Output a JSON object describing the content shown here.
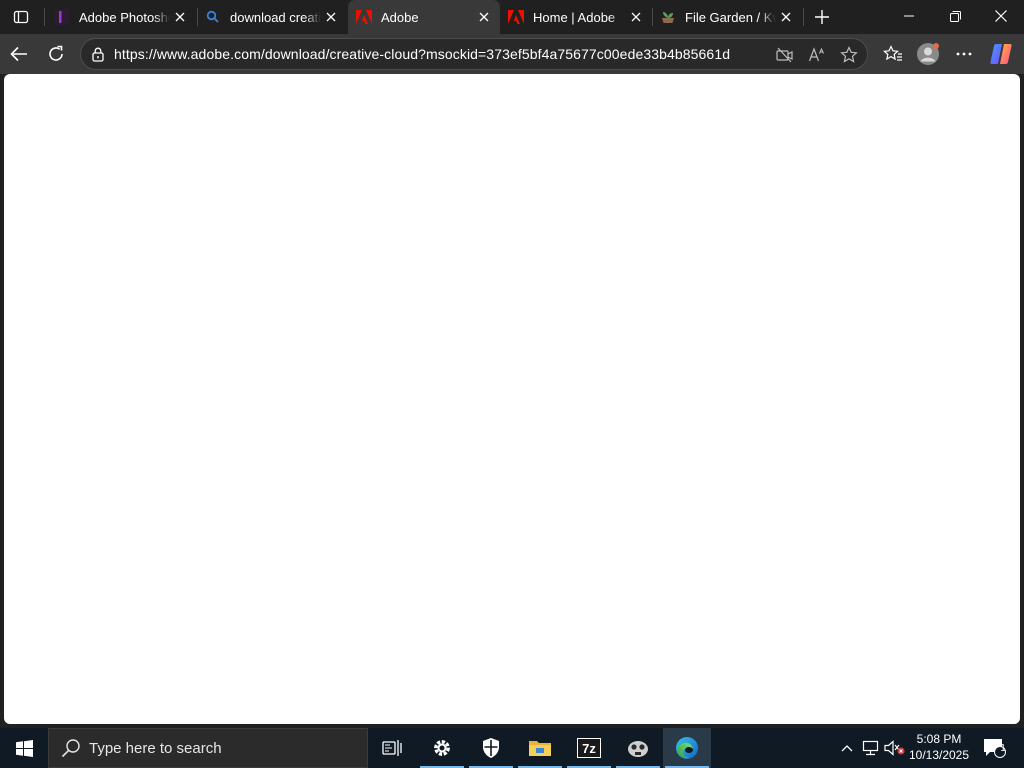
{
  "browser": {
    "tabs": [
      {
        "title": "Adobe Photoshop",
        "icon": "photoshop-favicon-icon",
        "active": false
      },
      {
        "title": "download creative cloud",
        "icon": "search-favicon-icon",
        "active": false
      },
      {
        "title": "Adobe",
        "icon": "adobe-favicon-icon",
        "active": true
      },
      {
        "title": "Home | Adobe",
        "icon": "adobe-favicon-icon",
        "active": false
      },
      {
        "title": "File Garden / Kvu",
        "icon": "file-garden-favicon-icon",
        "active": false
      }
    ],
    "address_bar": {
      "url": "https://www.adobe.com/download/creative-cloud?msockid=373ef5bf4a75677c00ede33b4b85661d"
    },
    "colors": {
      "tabstrip": "#202020",
      "active_tab": "#393939",
      "adobe_red": "#eb1000",
      "accent": "#76b9ed"
    }
  },
  "taskbar": {
    "search_placeholder": "Type here to search",
    "pinned": [
      "task-view-icon",
      "settings-icon",
      "windows-security-icon",
      "file-explorer-icon",
      "7zip-icon",
      "app-icon",
      "edge-icon"
    ],
    "clock": {
      "time": "5:08 PM",
      "date": "10/13/2025"
    },
    "notification_count": "1"
  }
}
